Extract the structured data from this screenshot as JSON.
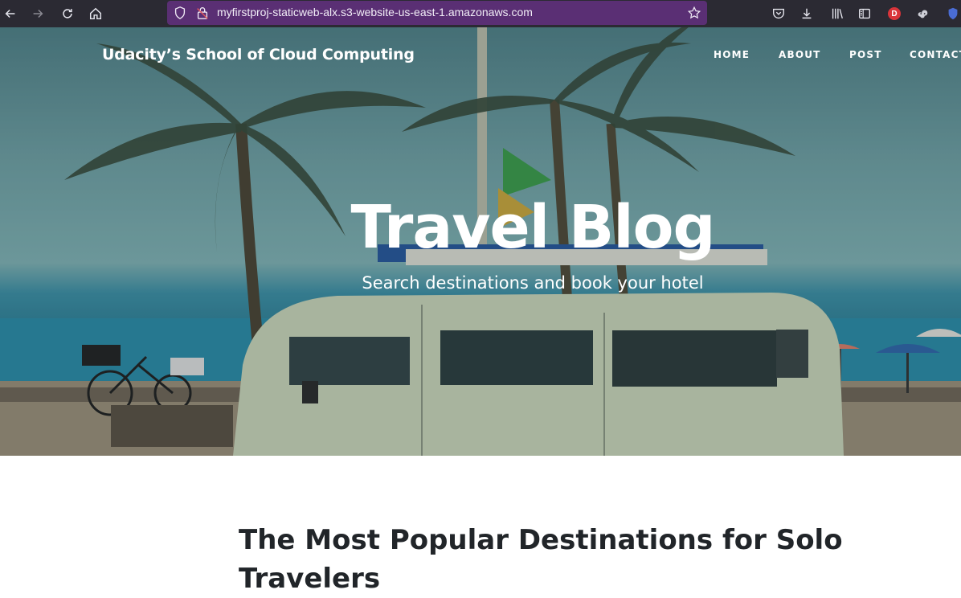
{
  "browser": {
    "url": "myfirstproj-staticweb-alx.s3-website-us-east-1.amazonaws.com",
    "avatar_letter": "D",
    "toolbar_bg": "#2b2a33",
    "urlbar_bg": "#5a2f74"
  },
  "site": {
    "brand": "Udacity’s School of Cloud Computing",
    "nav": [
      {
        "label": "HOME"
      },
      {
        "label": "ABOUT"
      },
      {
        "label": "POST"
      },
      {
        "label": "CONTACT"
      }
    ]
  },
  "hero": {
    "title": "Travel Blog",
    "subtitle": "Search destinations and book your hotel"
  },
  "main": {
    "post_title": "The Most Popular Destinations for Solo Travelers"
  }
}
